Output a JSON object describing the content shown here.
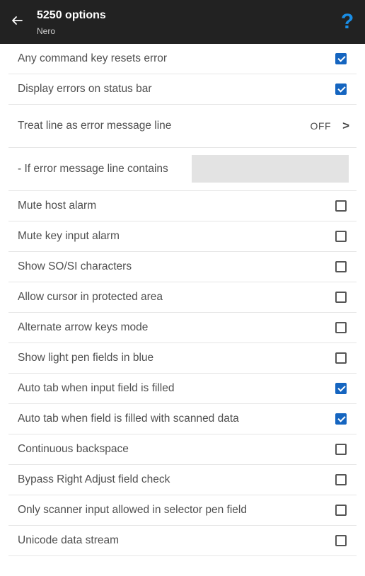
{
  "header": {
    "title": "5250 options",
    "subtitle": "Nero",
    "back_icon": "arrow-left-icon",
    "help_icon": "question-mark-icon",
    "help_glyph": "?",
    "accent_color": "#1a8ee6",
    "bar_color": "#222222"
  },
  "options": [
    {
      "label": "Any command key resets error",
      "checked": true
    },
    {
      "label": "Display errors on status bar",
      "checked": true
    },
    {
      "label": "Treat line as error message line",
      "value": "OFF"
    },
    {
      "label": "- If error message line contains",
      "text_value": ""
    },
    {
      "label": "Mute host alarm",
      "checked": false
    },
    {
      "label": "Mute key input alarm",
      "checked": false
    },
    {
      "label": "Show SO/SI characters",
      "checked": false
    },
    {
      "label": "Allow cursor in protected area",
      "checked": false
    },
    {
      "label": "Alternate arrow keys mode",
      "checked": false
    },
    {
      "label": "Show light pen fields in blue",
      "checked": false
    },
    {
      "label": "Auto tab when input field is filled",
      "checked": true
    },
    {
      "label": "Auto tab when field is filled with scanned data",
      "checked": true
    },
    {
      "label": "Continuous backspace",
      "checked": false
    },
    {
      "label": "Bypass Right Adjust field check",
      "checked": false
    },
    {
      "label": "Only scanner input allowed in selector pen field",
      "checked": false
    },
    {
      "label": "Unicode data stream",
      "checked": false
    }
  ],
  "checkbox_checked_color": "#1565c0",
  "chevron_glyph": ">"
}
